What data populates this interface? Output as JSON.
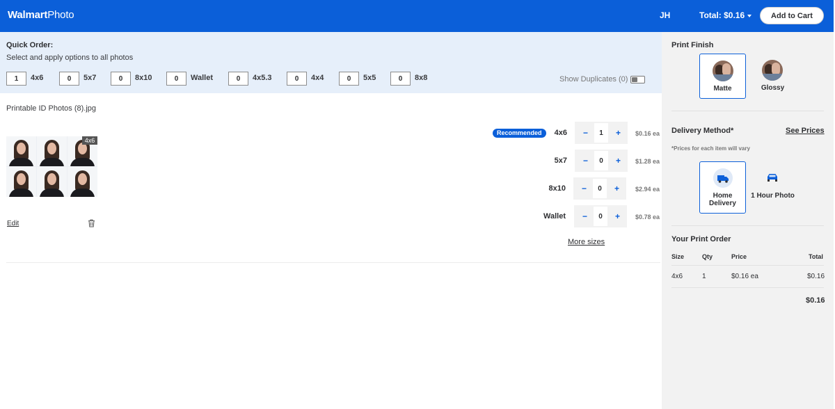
{
  "header": {
    "brand_bold": "Walmart",
    "brand_light": "Photo",
    "initials": "JH",
    "total": "Total: $0.16",
    "cart_label": "Add to Cart",
    "colors": {
      "brand": "#0b5fd9"
    }
  },
  "quick_order": {
    "title": "Quick Order:",
    "subtitle": "Select and apply options to all photos",
    "items": [
      {
        "value": "1",
        "label": "4x6"
      },
      {
        "value": "0",
        "label": "5x7"
      },
      {
        "value": "0",
        "label": "8x10"
      },
      {
        "value": "0",
        "label": "Wallet"
      },
      {
        "value": "0",
        "label": "4x5.3"
      },
      {
        "value": "0",
        "label": "4x4"
      },
      {
        "value": "0",
        "label": "5x5"
      },
      {
        "value": "0",
        "label": "8x8"
      }
    ],
    "duplicates_label": "Show Duplicates (0)"
  },
  "photo": {
    "filename": "Printable ID Photos (8).jpg",
    "thumb_tag": "4x6",
    "edit_label": "Edit",
    "recommended": "Recommended",
    "sizes": [
      {
        "label": "4x6",
        "qty": "1",
        "price": "$0.16 ea"
      },
      {
        "label": "5x7",
        "qty": "0",
        "price": "$1.28 ea"
      },
      {
        "label": "8x10",
        "qty": "0",
        "price": "$2.94 ea"
      },
      {
        "label": "Wallet",
        "qty": "0",
        "price": "$0.78 ea"
      }
    ],
    "minus": "−",
    "plus": "+",
    "more_sizes": "More sizes"
  },
  "panel": {
    "finish_title": "Print Finish",
    "finishes": [
      "Matte",
      "Glossy"
    ],
    "delivery_title": "Delivery Method*",
    "see_prices": "See Prices",
    "note": "*Prices for each item will vary",
    "delivery_line1": "Home",
    "delivery_line2": "Delivery",
    "delivery_alt": "1 Hour Photo",
    "order_title": "Your Print Order",
    "headers": [
      "Size",
      "Qty",
      "Price",
      "Total"
    ],
    "row": [
      "4x6",
      "1",
      "$0.16 ea",
      "$0.16"
    ],
    "grand_total": "$0.16"
  }
}
